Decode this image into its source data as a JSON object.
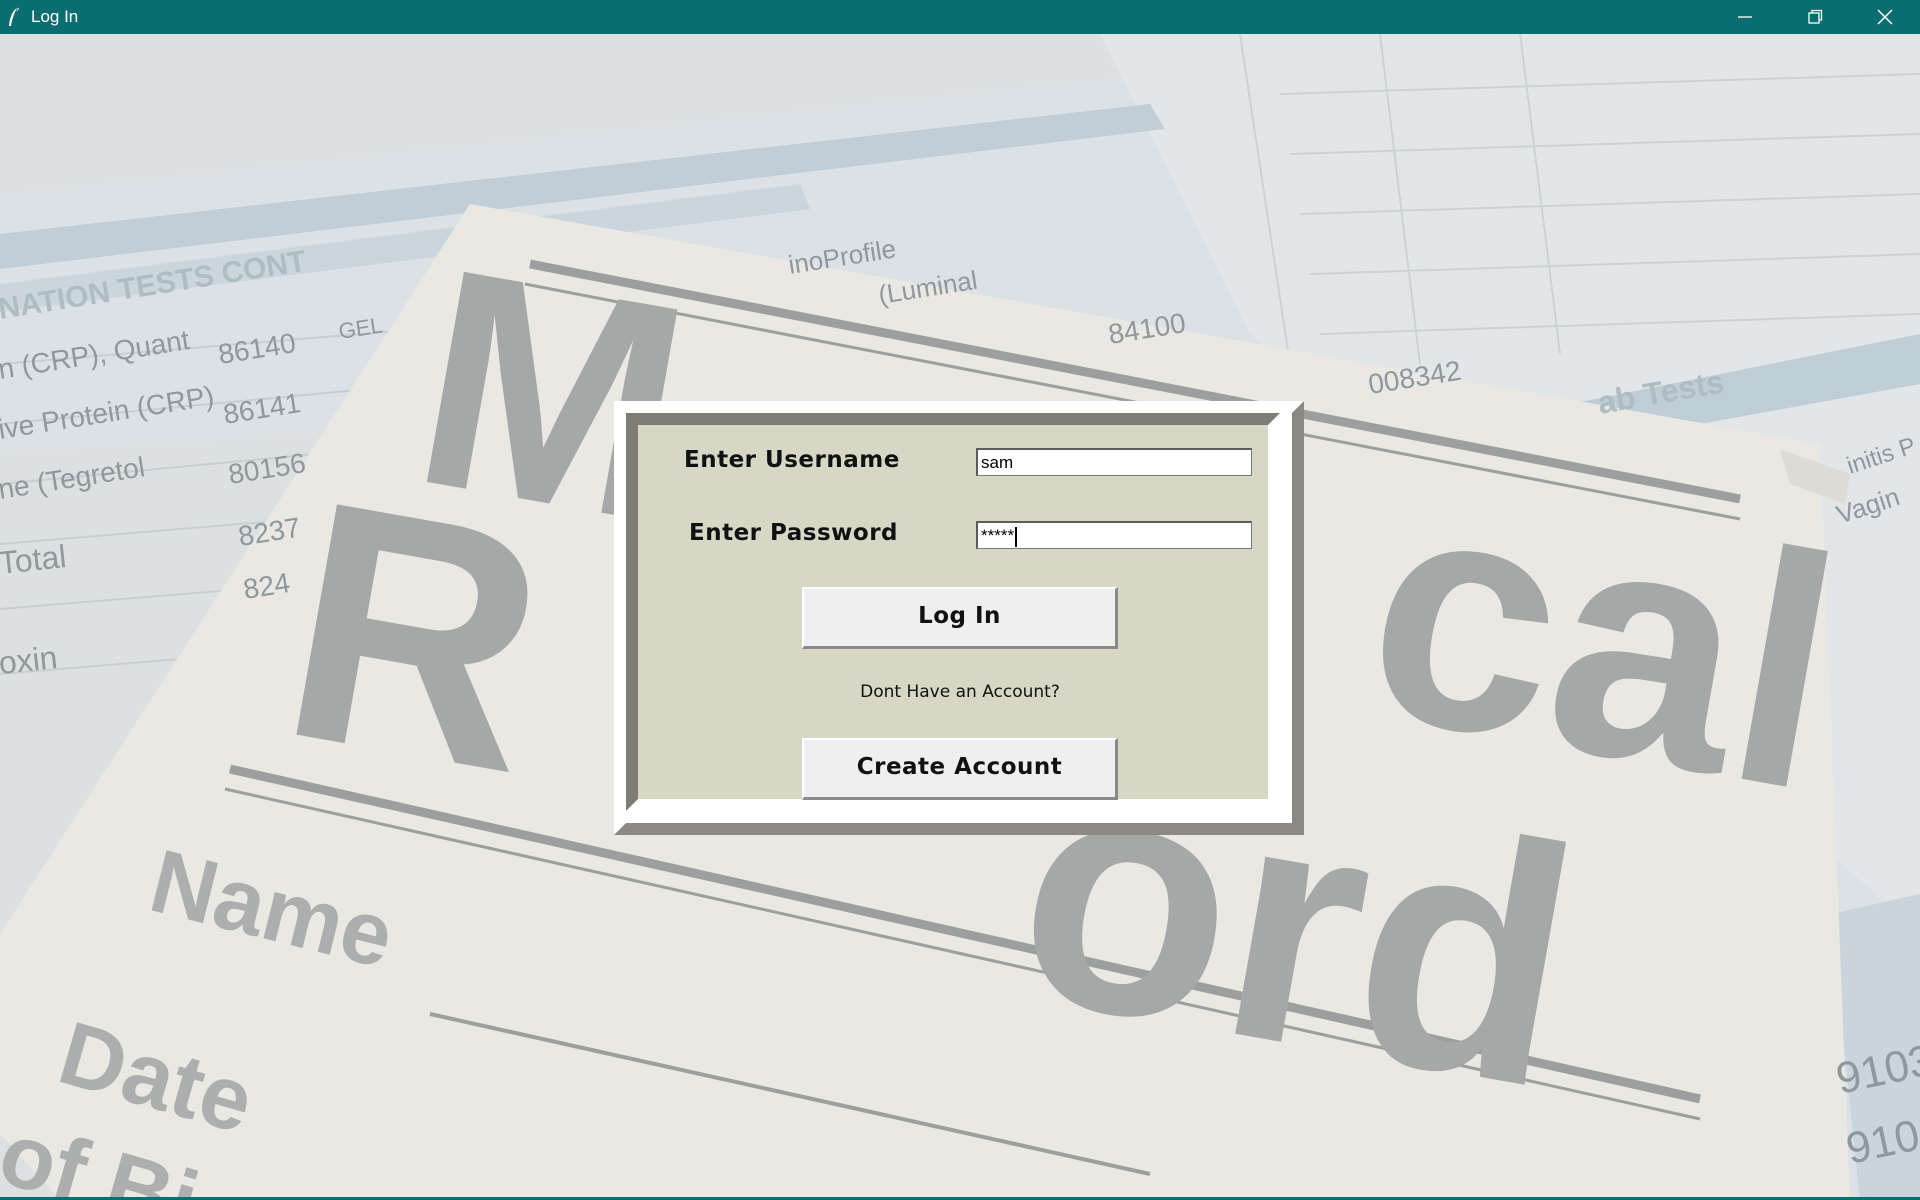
{
  "window": {
    "title": "Log In",
    "icon": "feather-icon",
    "controls": [
      "minimize-icon",
      "restore-icon",
      "close-icon"
    ],
    "titlebar_color": "#0a6e70"
  },
  "background": {
    "description_colors": {
      "paper": "#e6e4dd",
      "form": "#d3dbe0"
    },
    "texts": {
      "heading_m": "M",
      "heading_cal": "cal",
      "heading_r": "R",
      "heading_ord": "ord",
      "name": "Name",
      "date": "Date",
      "of": "of Bi",
      "nation_tests": "NATION TESTS CONT",
      "crp_quant": "n (CRP), Quant",
      "crp": "ive Protein (CRP)",
      "tegretol": "ne (Tegretol",
      "total": "Total",
      "oxin": "oxin",
      "code1": "86140",
      "code2": "86141",
      "code3": "80156",
      "code4": "8237",
      "code5": "824",
      "code6": "84100",
      "code7": "008342",
      "gel": "GEL",
      "lab_tests": "ab Tests",
      "luminal": "(Luminal",
      "profile": "inoProfile",
      "vagin": "Vagin",
      "initis": "initis P",
      "numbers1": "9103",
      "numbers2": "910"
    }
  },
  "dialog": {
    "colors": {
      "panel": "#d7d7c6"
    },
    "username": {
      "label": "Enter Username",
      "value": "sam"
    },
    "password": {
      "label": "Enter Password",
      "value": "*****"
    },
    "login_button": "Log In",
    "prompt": "Dont Have an Account?",
    "create_button": "Create Account"
  }
}
